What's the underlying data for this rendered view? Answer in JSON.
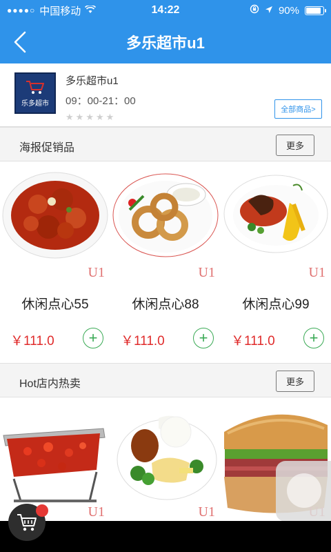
{
  "status_bar": {
    "carrier": "中国移动",
    "time": "14:22",
    "battery": "90%",
    "battery_level": 0.9
  },
  "nav": {
    "title": "多乐超市u1"
  },
  "store": {
    "logo_text": "乐多超市",
    "name": "多乐超市u1",
    "hours": "09：00-21：00",
    "rating_stars": 0,
    "all_products_label": "全部商品>"
  },
  "sections": [
    {
      "title": "海报促销品",
      "more_label": "更多",
      "products": [
        {
          "name": "休闲点心55",
          "price": "￥111.0",
          "watermark": "U1"
        },
        {
          "name": "休闲点心88",
          "price": "￥111.0",
          "watermark": "U1"
        },
        {
          "name": "休闲点心99",
          "price": "￥111.0",
          "watermark": "U1"
        }
      ]
    },
    {
      "title": "Hot店内热卖",
      "more_label": "更多",
      "products": [
        {
          "watermark": "U1"
        },
        {
          "watermark": "U1"
        },
        {
          "watermark": "U1"
        }
      ]
    }
  ],
  "colors": {
    "brand_blue": "#2f93ea",
    "price_red": "#e02b2b",
    "add_green": "#3aaa55"
  }
}
